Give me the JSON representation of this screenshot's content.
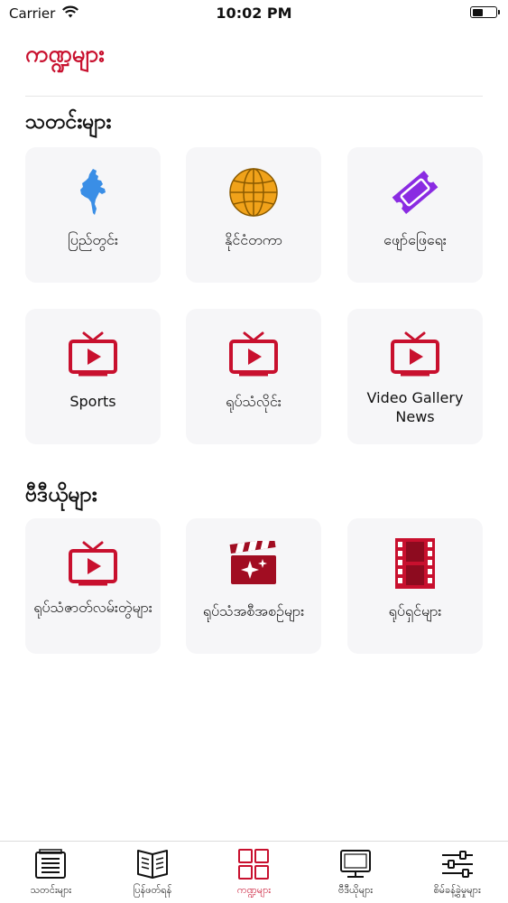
{
  "status_bar": {
    "carrier": "Carrier",
    "time": "10:02 PM"
  },
  "page_title": "ကဏ္ဍများ",
  "sections": [
    {
      "title": "သတင်းများ",
      "tiles": [
        {
          "label": "ပြည်တွင်း",
          "icon": "myanmar-map-icon"
        },
        {
          "label": "နိုင်ငံတကာ",
          "icon": "globe-icon"
        },
        {
          "label": "ဖျော်ဖြေရေး",
          "icon": "ticket-icon"
        },
        {
          "label": "Sports",
          "icon": "tv-icon"
        },
        {
          "label": "ရုပ်သံလိုင်း",
          "icon": "tv-icon"
        },
        {
          "label": "Video Gallery News",
          "icon": "tv-icon"
        }
      ]
    },
    {
      "title": "ဗီဒီယိုများ",
      "tiles": [
        {
          "label": "ရုပ်သံဇာတ်လမ်းတွဲများ",
          "icon": "tv-icon"
        },
        {
          "label": "ရုပ်သံအစီအစဉ်များ",
          "icon": "clapperboard-icon"
        },
        {
          "label": "ရုပ်ရှင်များ",
          "icon": "film-strip-icon"
        }
      ]
    }
  ],
  "tab_bar": {
    "active_index": 2,
    "items": [
      {
        "label": "သတင်းများ",
        "icon": "newspaper-icon"
      },
      {
        "label": "ပြန်ဖတ်ရန်",
        "icon": "open-book-icon"
      },
      {
        "label": "ကဏ္ဍများ",
        "icon": "grid-icon"
      },
      {
        "label": "ဗီဒီယိုများ",
        "icon": "monitor-icon"
      },
      {
        "label": "စိမ်ခန့်ခွဲမှုများ",
        "icon": "sliders-icon"
      }
    ]
  },
  "colors": {
    "accent": "#c8102e",
    "map": "#3a8ee6",
    "globe": "#f0a21a",
    "ticket": "#8a2be2",
    "tile_bg": "#f6f6f8"
  }
}
